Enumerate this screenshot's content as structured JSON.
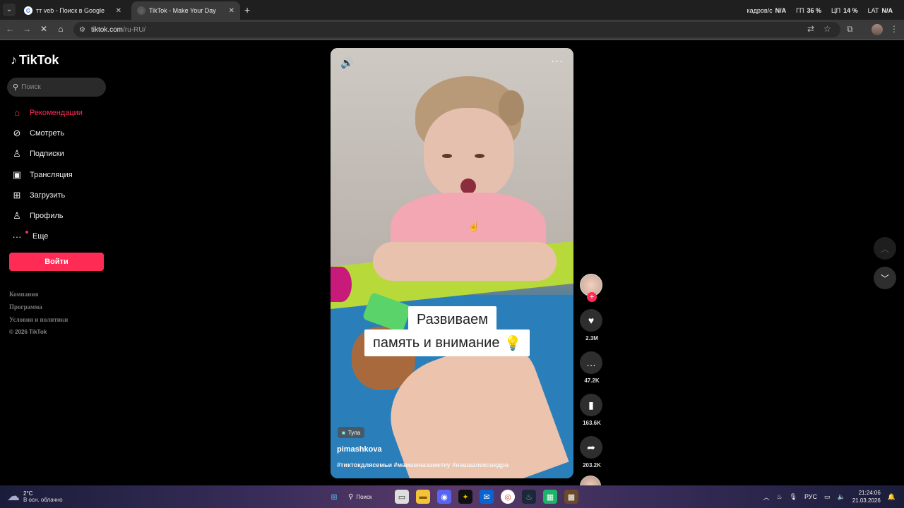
{
  "browser": {
    "tabs": [
      {
        "title": "тт veb - Поиск в Google",
        "active": false
      },
      {
        "title": "TikTok - Make Your Day",
        "active": true
      }
    ],
    "url_host": "tiktok.com",
    "url_path": "/ru-RU/",
    "overlay": {
      "fps_label": "кадров/с",
      "fps_value": "N/A",
      "gpu_label": "ГП",
      "gpu_value": "36 %",
      "cpu_label": "ЦП",
      "cpu_value": "14 %",
      "lat_label": "LAT",
      "lat_value": "N/A"
    }
  },
  "sidebar": {
    "logo": "TikTok",
    "search_placeholder": "Поиск",
    "items": [
      {
        "label": "Рекомендации",
        "icon": "home-icon",
        "active": true
      },
      {
        "label": "Смотреть",
        "icon": "compass-icon"
      },
      {
        "label": "Подписки",
        "icon": "following-icon"
      },
      {
        "label": "Трансляция",
        "icon": "live-icon"
      },
      {
        "label": "Загрузить",
        "icon": "upload-icon"
      },
      {
        "label": "Профиль",
        "icon": "profile-icon"
      },
      {
        "label": "Еще",
        "icon": "more-icon"
      }
    ],
    "login": "Войти",
    "footer": [
      "Компания",
      "Программа",
      "Условия и политики"
    ],
    "copyright": "© 2026 TikTok"
  },
  "video": {
    "caption_line1": "Развиваем",
    "caption_line2": "память и внимание",
    "caption_emoji": "💡",
    "location": "Тула",
    "author": "pimashkova",
    "hashtags": "#тиктокдлясемьи #мамамназаметку #нашаалександра"
  },
  "actions": {
    "likes": "2.3M",
    "comments": "47.2K",
    "saves": "163.6K",
    "shares": "203.2K"
  },
  "taskbar": {
    "temp": "2°C",
    "weather": "В осн. облачно",
    "search": "Поиск",
    "lang": "РУС",
    "time": "21:24:06",
    "date": "21.03.2026"
  }
}
